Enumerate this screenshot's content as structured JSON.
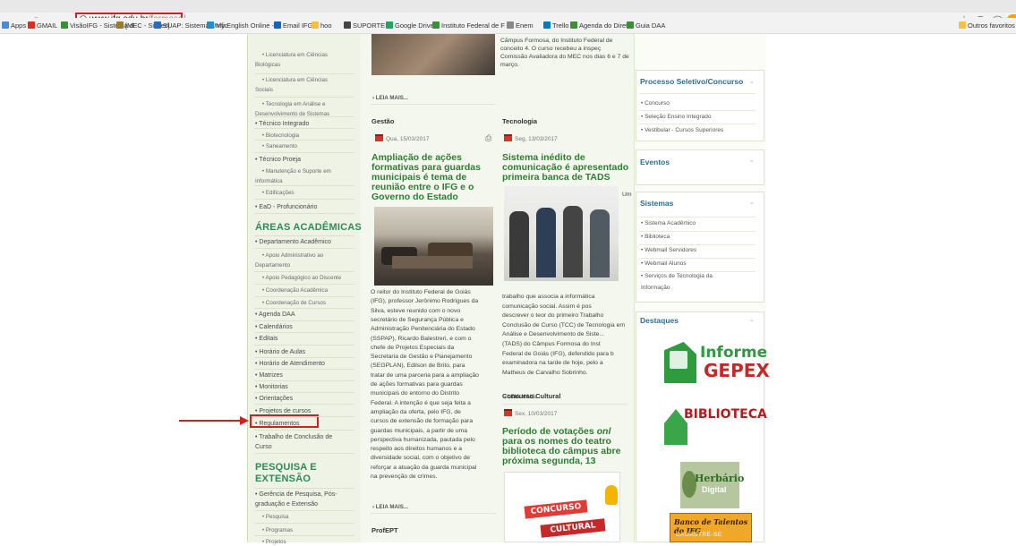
{
  "browser": {
    "nav": [
      "←",
      "→",
      "C",
      "⌂"
    ],
    "url_domain": "www.ifg.edu.br",
    "url_path": "/formosa/",
    "bookmarks": [
      {
        "label": "Apps",
        "color": "#4a8bd6"
      },
      {
        "label": "GMAIL",
        "color": "#d93025"
      },
      {
        "label": "VisãoIFG - Sistema d",
        "color": "#3b8f3b"
      },
      {
        "label": "[MEC - SisTec]",
        "color": "#9b7b2e"
      },
      {
        "label": "SUAP: Sistema Unific",
        "color": "#2a6ebb"
      },
      {
        "label": "My English Online - C",
        "color": "#1f8fd1"
      },
      {
        "label": "Email IFG",
        "color": "#1565c0"
      },
      {
        "label": "hoo",
        "color": "#f4c042"
      },
      {
        "label": "SUPORTE",
        "color": "#444444"
      },
      {
        "label": "Google Drive",
        "color": "#1fa463"
      },
      {
        "label": "Instituto Federal de F",
        "color": "#3b8f3b"
      },
      {
        "label": "Enem",
        "color": "#888888"
      },
      {
        "label": "Trello",
        "color": "#0079bf"
      },
      {
        "label": "Agenda do Diretor",
        "color": "#3b8f3b"
      },
      {
        "label": "Guia DAA",
        "color": "#3b8f3b"
      },
      {
        "label": "Outros favoritos",
        "color": "#f4c042"
      }
    ],
    "toolbar_icons": [
      "☆",
      "≡",
      "⌒"
    ]
  },
  "left_menu": {
    "items": [
      {
        "text": "• Licenciatura em Ciências",
        "kind": "sub"
      },
      {
        "text": "Biológicas",
        "kind": "sub"
      },
      {
        "text": "• Licenciatura em Ciências",
        "kind": "sub"
      },
      {
        "text": "Sociais",
        "kind": "sub"
      },
      {
        "text": "• Tecnologia em Análise e",
        "kind": "sub"
      },
      {
        "text": "Desenvolvimento de Sistemas",
        "kind": "sub"
      },
      {
        "text": "• Técnico Integrado",
        "kind": "main"
      },
      {
        "text": "• Biotecnologia",
        "kind": "sub"
      },
      {
        "text": "• Saneamento",
        "kind": "sub"
      },
      {
        "text": "• Técnico Proeja",
        "kind": "main"
      },
      {
        "text": "• Manutenção e Suporte em",
        "kind": "sub"
      },
      {
        "text": "Informática",
        "kind": "sub"
      },
      {
        "text": "• Edificações",
        "kind": "sub"
      },
      {
        "text": "• EaD - Profuncionário",
        "kind": "main"
      }
    ],
    "areas_heading": "ÁREAS ACADÊMICAS",
    "areas": [
      {
        "text": "• Departamento Acadêmico",
        "kind": "main"
      },
      {
        "text": "• Apoio Administrativo ao",
        "kind": "sub"
      },
      {
        "text": "Departamento",
        "kind": "sub"
      },
      {
        "text": "• Apoio Pedagógico ao Discente",
        "kind": "sub"
      },
      {
        "text": "• Coordenação Acadêmica",
        "kind": "sub"
      },
      {
        "text": "• Coordenação de Cursos",
        "kind": "sub"
      },
      {
        "text": "• Agenda DAA",
        "kind": "main"
      },
      {
        "text": "• Calendários",
        "kind": "main"
      },
      {
        "text": "• Editais",
        "kind": "main"
      },
      {
        "text": "• Horário de Aulas",
        "kind": "main"
      },
      {
        "text": "• Horário de Atendimento",
        "kind": "main"
      },
      {
        "text": "• Matrizes",
        "kind": "main"
      },
      {
        "text": "• Monitorias",
        "kind": "main"
      },
      {
        "text": "• Orientações",
        "kind": "main"
      },
      {
        "text": "• Projetos de cursos",
        "kind": "main"
      },
      {
        "text": "• Regulamentos",
        "kind": "main"
      },
      {
        "text": "• Trabalho de Conclusão de",
        "kind": "main"
      },
      {
        "text": "Curso",
        "kind": "main"
      }
    ],
    "pesquisa_heading_1": "PESQUISA E",
    "pesquisa_heading_2": "EXTENSÃO",
    "pesquisa": [
      {
        "text": "• Gerência de Pesquisa, Pós-",
        "kind": "main"
      },
      {
        "text": "graduação e Extensão",
        "kind": "main"
      },
      {
        "text": "• Pesquisa",
        "kind": "sub"
      },
      {
        "text": "• Programas",
        "kind": "sub"
      },
      {
        "text": "• Projetos",
        "kind": "sub"
      }
    ]
  },
  "center": {
    "top_text": [
      "Câmpus Formosa, do Instituto Federal de",
      "conceito 4. O curso recebeu a inspeç",
      "Comissão Avaliadora do MEC nos dias 6 e 7 de",
      "março."
    ],
    "leia_mais": "› LEIA MAIS...",
    "col1": {
      "category": "Gestão",
      "date": "Qua, 15/03/2017",
      "headline": [
        "Ampliação de ações",
        "formativas para guardas",
        "municipais é tema de",
        "reunião entre o IFG e o",
        "Governo do Estado"
      ],
      "body": [
        "O reitor do Instituto Federal de Goiás",
        "(IFG), professor Jerônimo Rodrigues da",
        "Silva, esteve reunido com o novo",
        "secretário de Segurança Pública e",
        "Administração Penitenciária do Estado",
        "(SSPAP), Ricardo Balestreri, e com o",
        "chefe de Projetos Especiais da",
        "Secretaria de Gestão e Planejamento",
        "(SEGPLAN), Edilson de Brito, para",
        "tratar de uma parceria para a ampliação",
        "de ações formativas para guardas",
        "municipais do entorno do Distrito",
        "Federal. A intenção é que seja feita a",
        "ampliação da oferta, pelo IFG, de",
        "cursos de extensão de formação para",
        "guardas municipais, a partir de uma",
        "perspectiva humanizada, pautada pelo",
        "respeito aos direitos humanos e a",
        "diversidade social, com o objetivo de",
        "reforçar a atuação da guarda municipal",
        "na prevenção de crimes."
      ],
      "next_category": "ProfEPT"
    },
    "col2": {
      "category": "Tecnologia",
      "date": "Seg, 13/03/2017",
      "headline": [
        "Sistema inédito de",
        "comunicação é apresentado",
        "primeira banca de TADS"
      ],
      "um": "Um",
      "body": [
        "trabalho que associa a informática",
        "comunicação social. Assim é pos",
        "descrever o teor do primeiro Trabalho",
        "Conclusão de Curso (TCC) de Tecnologia em",
        "Análise e Desenvolvimento de Siste...",
        "(TADS) do Câmpus Formosa do Inst",
        "Federal de Goiás (IFG), defendido para b",
        "examinadora na tarde de hoje, pelo a",
        "Matheus de Carvalho Sobrinho."
      ],
      "category2": "Concurso Cultural",
      "date2": "Sex, 10/03/2017",
      "headline2_a": "Período de votações",
      "headline2_b": "onl",
      "headline2_rest": [
        "para os nomes do teatro",
        "biblioteca do câmpus abre",
        "próxima segunda, 13"
      ],
      "concurso_1": "CONCURSO",
      "concurso_2": "CULTURAL"
    }
  },
  "right": {
    "processo_title": "Processo Seletivo/Concurso",
    "processo_items": [
      "• Concurso",
      "• Seleção Ensino Integrado",
      "• Vestibular - Cursos Superiores"
    ],
    "eventos_title": "Eventos",
    "sistemas_title": "Sistemas",
    "sistemas_items": [
      "• Sistema Acadêmico",
      "• Biblioteca",
      "• Webmail Servidores",
      "• Webmail Alunos",
      "• Serviços de Tecnologia da",
      "Informação"
    ],
    "destaques_title": "Destaques",
    "informe_1": "Informe",
    "informe_2": "GEPEX",
    "biblioteca": "BIBLIOTECA",
    "herbario_1": "Herbário",
    "herbario_2": "Digital",
    "talentos": "Banco de Talentos do IFG",
    "talentos_sub": "CADASTRE-SE"
  },
  "colors": {
    "accent_red": "#d4201d",
    "green": "#2e7d32",
    "blue_head": "#2c6e8f"
  }
}
